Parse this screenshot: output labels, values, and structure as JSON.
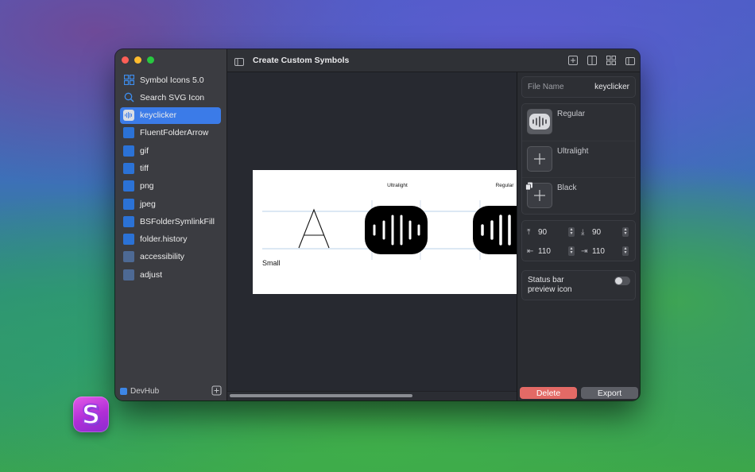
{
  "window": {
    "title": "Create Custom Symbols"
  },
  "sidebar": {
    "items": [
      {
        "label": "Symbol Icons 5.0",
        "icon": "grid-icon",
        "selected": false
      },
      {
        "label": "Search SVG Icon",
        "icon": "search-icon",
        "selected": false
      },
      {
        "label": "keyclicker",
        "icon": "waveform-icon",
        "selected": true
      },
      {
        "label": "FluentFolderArrow",
        "icon": "symbol-icon",
        "selected": false
      },
      {
        "label": "gif",
        "icon": "symbol-icon",
        "selected": false
      },
      {
        "label": "tiff",
        "icon": "symbol-icon",
        "selected": false
      },
      {
        "label": "png",
        "icon": "symbol-icon",
        "selected": false
      },
      {
        "label": "jpeg",
        "icon": "symbol-icon",
        "selected": false
      },
      {
        "label": "BSFolderSymlinkFill",
        "icon": "symbol-icon",
        "selected": false
      },
      {
        "label": "folder.history",
        "icon": "symbol-icon",
        "selected": false
      },
      {
        "label": "accessibility",
        "icon": "symbol-icon",
        "selected": false
      },
      {
        "label": "adjust",
        "icon": "symbol-icon",
        "selected": false
      }
    ],
    "footer_label": "DevHub"
  },
  "preview": {
    "small_label": "Small",
    "glyph_letter": "A",
    "weight_labels": [
      "Ultralight",
      "Regular"
    ]
  },
  "inspector": {
    "file_name_label": "File Name",
    "file_name_value": "keyclicker",
    "weights": [
      "Regular",
      "Ultralight",
      "Black"
    ],
    "margins": {
      "top": "90",
      "bottom": "90",
      "left": "110",
      "right": "110"
    },
    "status_bar_label": "Status bar preview icon",
    "status_bar_enabled": false,
    "delete_label": "Delete",
    "export_label": "Export"
  },
  "dock": {
    "app_letter": "S"
  },
  "colors": {
    "accent": "#3b7be8",
    "delete": "#e36a66"
  }
}
